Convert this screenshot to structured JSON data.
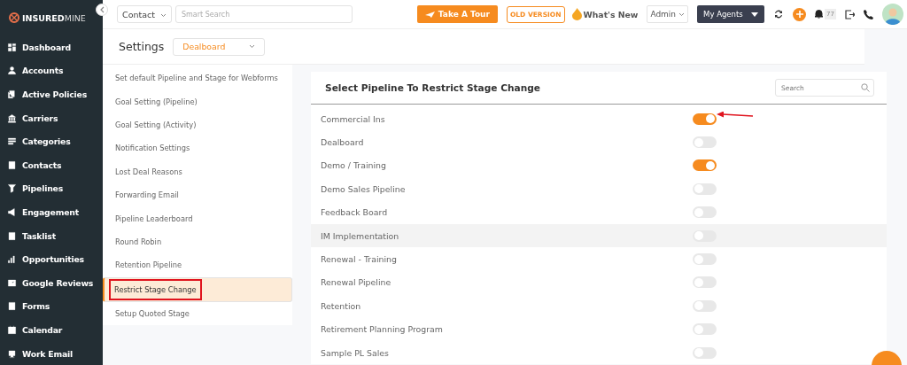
{
  "brand": {
    "name_bold": "INSURED",
    "name_light": "MINE"
  },
  "topbar": {
    "entity_select": "Contact",
    "search": {
      "placeholder": "Smart Search"
    },
    "tour_button": "Take A Tour",
    "old_version_button": "OLD VERSION",
    "whats_new": "What's New",
    "role_select": "Admin",
    "agents_select": "My Agents",
    "notification_count": "77"
  },
  "sidebar": {
    "items": [
      {
        "label": "Dashboard"
      },
      {
        "label": "Accounts"
      },
      {
        "label": "Active Policies"
      },
      {
        "label": "Carriers"
      },
      {
        "label": "Categories"
      },
      {
        "label": "Contacts"
      },
      {
        "label": "Pipelines"
      },
      {
        "label": "Engagement"
      },
      {
        "label": "Tasklist"
      },
      {
        "label": "Opportunities"
      },
      {
        "label": "Google Reviews"
      },
      {
        "label": "Forms"
      },
      {
        "label": "Calendar"
      },
      {
        "label": "Work Email"
      }
    ]
  },
  "settings": {
    "title": "Settings",
    "module_select": "Dealboard",
    "menu": [
      {
        "label": "Set default Pipeline and Stage for Webforms",
        "selected": false,
        "highlighted": false
      },
      {
        "label": "Goal Setting (Pipeline)",
        "selected": false,
        "highlighted": false
      },
      {
        "label": "Goal Setting (Activity)",
        "selected": false,
        "highlighted": false
      },
      {
        "label": "Notification Settings",
        "selected": false,
        "highlighted": false
      },
      {
        "label": "Lost Deal Reasons",
        "selected": false,
        "highlighted": false
      },
      {
        "label": "Forwarding Email",
        "selected": false,
        "highlighted": false
      },
      {
        "label": "Pipeline Leaderboard",
        "selected": false,
        "highlighted": false
      },
      {
        "label": "Round Robin",
        "selected": false,
        "highlighted": false
      },
      {
        "label": "Retention Pipeline",
        "selected": false,
        "highlighted": false
      },
      {
        "label": "Restrict Stage Change",
        "selected": true,
        "highlighted": true
      },
      {
        "label": "Setup Quoted Stage",
        "selected": false,
        "highlighted": false
      }
    ]
  },
  "panel": {
    "title": "Select Pipeline To Restrict Stage Change",
    "search": {
      "placeholder": "Search"
    },
    "pipelines": [
      {
        "name": "Commercial Ins",
        "on": true,
        "hovered": false,
        "pointed": true
      },
      {
        "name": "Dealboard",
        "on": false,
        "hovered": false,
        "pointed": false
      },
      {
        "name": "Demo / Training",
        "on": true,
        "hovered": false,
        "pointed": false
      },
      {
        "name": "Demo Sales Pipeline",
        "on": false,
        "hovered": false,
        "pointed": false
      },
      {
        "name": "Feedback Board",
        "on": false,
        "hovered": false,
        "pointed": false
      },
      {
        "name": "IM Implementation",
        "on": false,
        "hovered": true,
        "pointed": false
      },
      {
        "name": "Renewal - Training",
        "on": false,
        "hovered": false,
        "pointed": false
      },
      {
        "name": "Renewal Pipeline",
        "on": false,
        "hovered": false,
        "pointed": false
      },
      {
        "name": "Retention",
        "on": false,
        "hovered": false,
        "pointed": false
      },
      {
        "name": "Retirement Planning Program",
        "on": false,
        "hovered": false,
        "pointed": false
      },
      {
        "name": "Sample PL Sales",
        "on": false,
        "hovered": false,
        "pointed": false
      }
    ]
  }
}
